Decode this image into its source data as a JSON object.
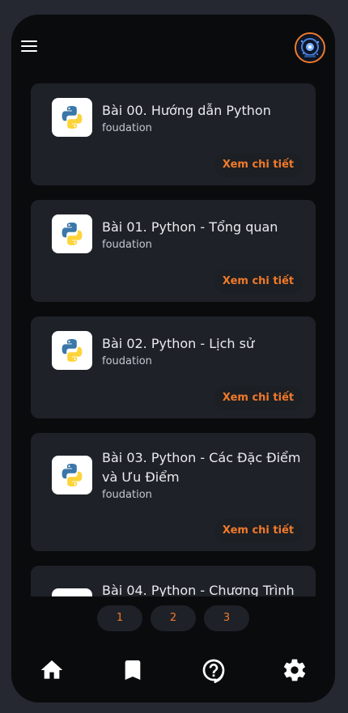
{
  "header": {
    "menu_icon": "hamburger-menu-icon",
    "avatar_icon": "user-avatar"
  },
  "lessons": [
    {
      "title": "Bài 00. Hướng dẫn Python",
      "subtitle": "foudation",
      "action": "Xem chi tiết"
    },
    {
      "title": "Bài 01. Python - Tổng quan",
      "subtitle": "foudation",
      "action": "Xem chi tiết"
    },
    {
      "title": "Bài 02. Python - Lịch sử",
      "subtitle": "foudation",
      "action": "Xem chi tiết"
    },
    {
      "title": "Bài 03. Python - Các Đặc Điểm và Ưu Điểm",
      "subtitle": "foudation",
      "action": "Xem chi tiết"
    },
    {
      "title": "Bài 04. Python - Chương Trình",
      "subtitle": "",
      "action": ""
    }
  ],
  "pagination": {
    "pages": [
      "1",
      "2",
      "3"
    ]
  },
  "bottom_nav": {
    "items": [
      "home-icon",
      "bookmark-icon",
      "help-icon",
      "settings-icon"
    ]
  },
  "colors": {
    "accent": "#f07a2a",
    "background": "#0a0b0d",
    "card": "#1e2127"
  }
}
